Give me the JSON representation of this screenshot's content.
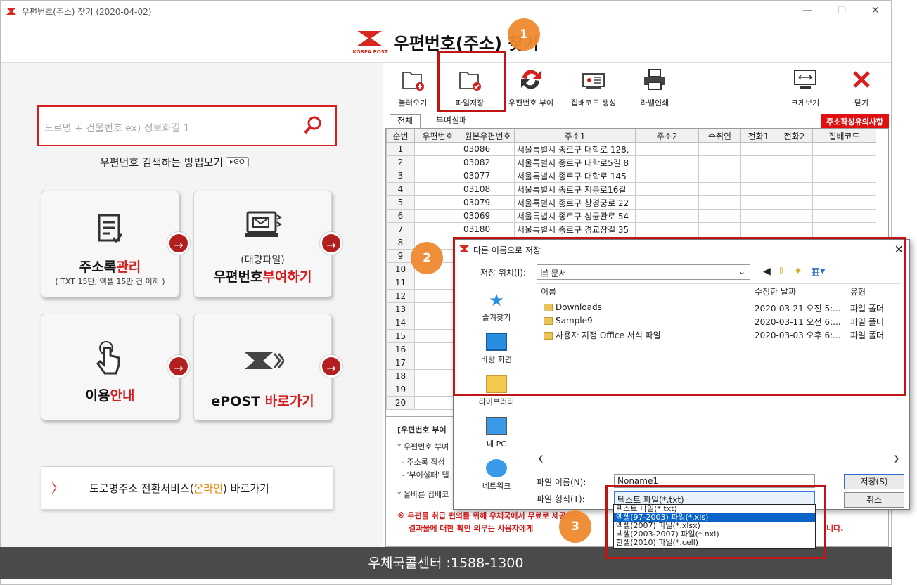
{
  "window": {
    "title": "우편번호(주소) 찾기 (2020-04-02)",
    "header": "우편번호(주소) 찾기",
    "brand": "KOREA POST"
  },
  "search": {
    "placeholder": "도로명 + 건물번호 ex) 정보화길 1"
  },
  "howto": {
    "label": "우편번호 검색하는 방법보기",
    "go": "▸GO"
  },
  "tiles": [
    {
      "title_a": "주소록",
      "title_b": "관리",
      "sub": "( TXT 15만, 엑셀 15만 건 이하 )"
    },
    {
      "pre": "(대량파일)",
      "title_a": "우편번호",
      "title_b": "부여하기"
    },
    {
      "title_a": "이용",
      "title_b": "안내"
    },
    {
      "title_a": "ePOST ",
      "title_b": "바로가기"
    }
  ],
  "road": {
    "a": "도로명주소 전환서비스(",
    "b": "온라인",
    "c": ") 바로가기"
  },
  "toolbar": {
    "open": "불러오기",
    "save": "파일저장",
    "assign": "우편번호 부여",
    "barcode": "집배코드 생성",
    "print": "라벨인쇄",
    "view": "크게보기",
    "close": "닫기"
  },
  "tabs": {
    "all": "전체",
    "fail": "부여실패",
    "warn": "주소작성유의사항"
  },
  "grid": {
    "headers": [
      "순번",
      "우편번호",
      "원본우편번호",
      "주소1",
      "주소2",
      "수취인",
      "전화1",
      "전화2",
      "집배코드"
    ],
    "rows": [
      [
        "1",
        "",
        "03086",
        "서울특별시 종로구 대학로 128,"
      ],
      [
        "2",
        "",
        "03082",
        "서울특별시 종로구 대학로5길 8"
      ],
      [
        "3",
        "",
        "03077",
        "서울특별시 종로구 대학로 145"
      ],
      [
        "4",
        "",
        "03108",
        "서울특별시 종로구 지봉로16길"
      ],
      [
        "5",
        "",
        "03079",
        "서울특별시 종로구 창경궁로 22"
      ],
      [
        "6",
        "",
        "03069",
        "서울특별시 종로구 성균관로 54"
      ],
      [
        "7",
        "",
        "03180",
        "서울특별시 종로구 경교장길 35"
      ],
      [
        "8",
        "",
        "",
        ""
      ],
      [
        "9",
        "",
        "",
        ""
      ],
      [
        "10",
        "",
        "",
        ""
      ],
      [
        "11",
        "",
        "",
        ""
      ],
      [
        "12",
        "",
        "",
        ""
      ],
      [
        "13",
        "",
        "",
        ""
      ],
      [
        "14",
        "",
        "",
        ""
      ],
      [
        "15",
        "",
        "",
        ""
      ],
      [
        "16",
        "",
        "",
        ""
      ],
      [
        "17",
        "",
        "",
        ""
      ],
      [
        "18",
        "",
        "",
        ""
      ],
      [
        "19",
        "",
        "",
        ""
      ],
      [
        "20",
        "",
        "",
        ""
      ]
    ]
  },
  "notes": {
    "l1": "[우편번호 부여",
    "l2": "* 우편번호 부여",
    "l3": "- 주소록 작성",
    "l4": "- '부여실패' 탭",
    "l5": "* 올바른 집배코",
    "l6": "※ 우편물 취급 편의를 위해 우체국에서 무료로 제공하는",
    "l6b": "결과물에 대한 확인 의무는 사용자에게",
    "l6c": "니다."
  },
  "callcenter": "우체국콜센터 :1588-1300",
  "dialog": {
    "title": "다른 이름으로 저장",
    "location_label": "저장 위치(I):",
    "location": "문서",
    "places": [
      "즐겨찾기",
      "바탕 화면",
      "라이브러리",
      "내 PC",
      "네트워크"
    ],
    "columns": [
      "이름",
      "수정한 날짜",
      "유형"
    ],
    "files": [
      {
        "name": "Downloads",
        "date": "2020-03-21 오전 5:...",
        "type": "파일 폴더"
      },
      {
        "name": "Sample9",
        "date": "2020-03-11 오전 6:...",
        "type": "파일 폴더"
      },
      {
        "name": "사용자 지정 Office 서식 파일",
        "date": "2020-03-03 오후 6:...",
        "type": "파일 폴더"
      }
    ],
    "filename_label": "파일 이름(N):",
    "filename": "Noname1",
    "filetype_label": "파일 형식(T):",
    "filetype": "텍스트 파일(*.txt)",
    "save": "저장(S)",
    "cancel": "취소",
    "options": [
      "텍스트 파일(*.txt)",
      "엑셀(97-2003) 파일(*.xls)",
      "엑셀(2007) 파일(*.xlsx)",
      "넥셀(2003-2007) 파일(*.nxl)",
      "한셀(2010) 파일(*.cell)"
    ]
  },
  "badges": [
    "1",
    "2",
    "3"
  ],
  "colors": {
    "accent": "#d61e1e",
    "highlight": "#c01515",
    "badge": "#f08a30"
  }
}
